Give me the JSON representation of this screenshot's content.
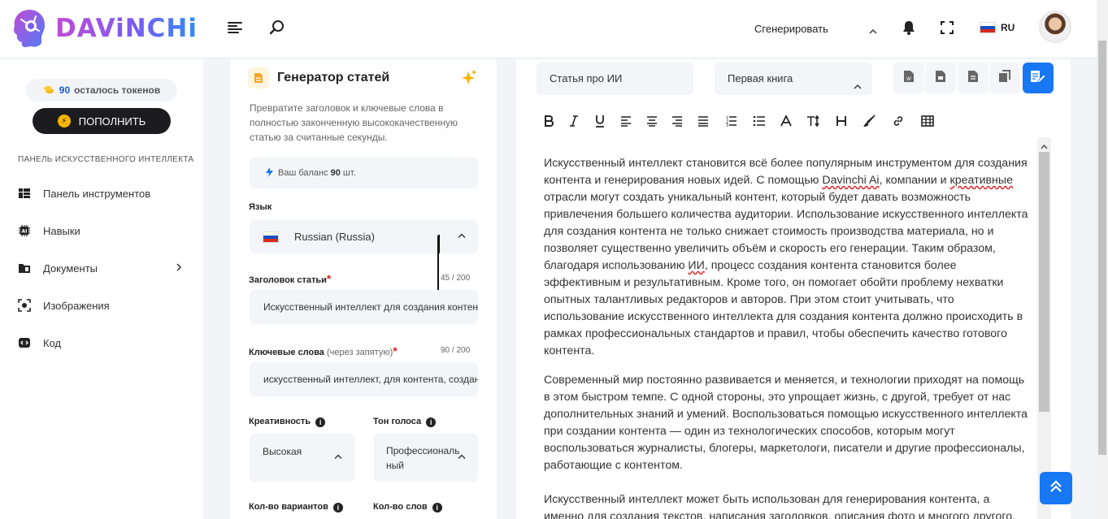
{
  "brand": {
    "name": "DAViNCHi"
  },
  "header": {
    "generate_label": "Сгенерировать",
    "language": "RU"
  },
  "sidebar": {
    "tokens_count": "90",
    "tokens_text": "осталось токенов",
    "topup_label": "ПОПОЛНИТЬ",
    "section_title": "ПАНЕЛЬ ИСКУССТВЕННОГО ИНТЕЛЛЕКТА",
    "items": [
      {
        "label": "Панель инструментов",
        "icon": "dashboard-icon"
      },
      {
        "label": "Навыки",
        "icon": "ai-chip-icon"
      },
      {
        "label": "Документы",
        "icon": "folder-icon"
      },
      {
        "label": "Изображения",
        "icon": "image-icon"
      },
      {
        "label": "Код",
        "icon": "code-icon"
      }
    ]
  },
  "form": {
    "title": "Генератор статей",
    "description": "Превратите заголовок и ключевые слова в полностью законченную высококачественную статью за считанные секунды.",
    "balance_prefix": "Ваш баланс",
    "balance_value": "90",
    "balance_suffix": "шт.",
    "language_label": "Язык",
    "language_value": "Russian (Russia)",
    "title_label": "Заголовок статьи",
    "title_counter": "45 / 200",
    "title_value": "Искусственный интеллект для создания контента",
    "keywords_label": "Ключевые слова",
    "keywords_hint": "(через запятую)",
    "keywords_counter": "90 / 200",
    "keywords_value": "искусственный интеллект, для контента, создание контента, генерирование идей",
    "creativity_label": "Креативность",
    "creativity_value": "Высокая",
    "tone_label": "Тон голоса",
    "tone_value_1": "Профессиональ",
    "tone_value_2": "ный",
    "variants_label": "Кол-во вариантов",
    "words_label": "Кол-во слов"
  },
  "editor": {
    "doc_name": "Статья про ИИ",
    "folder_value": "Первая книга",
    "paragraphs": {
      "p1_a": "Искусственный интеллект становится всё более популярным инструментом для создания контента и генерирования новых идей. С помощью ",
      "p1_davinchi": "Davinchi Ai",
      "p1_b": ", компании и ",
      "p1_creative": "креативные",
      "p1_c": " отрасли могут создать уникальный контент, который будет давать возможность привлечения большего количества аудитории. Использование искусственного интеллекта для создания контента не только снижает стоимость производства материала, но и позволяет существенно увеличить объём и скорость его генерации. Таким образом, благодаря использованию ",
      "p1_ii": "ИИ",
      "p1_d": ", процесс создания контента становится более эффективным и результативным. Кроме того, он помогает обойти проблему нехватки опытных  талантливых редакторов и авторов. При этом стоит учитывать, что использование искусственного интеллекта для создания контента должно происходить в рамках профессиональных стандартов и правил, чтобы обеспечить качество готового контента.",
      "p2": "Современный мир постоянно развивается и меняется, и технологии приходят на помощь в этом быстром темпе. С одной стороны, это упрощает жизнь, с другой, требует от нас дополнительных знаний и умений. Воспользоваться помощью искусственного интеллекта при создании контента — один из технологических способов, которым могут воспользоваться журналисты, блогеры, маркетологи, писатели и другие профессионалы, работающие с контентом.",
      "p3": "Искусственный интеллект может быть использован для генерирования контента, а именно для создания текстов, написания заголовков, описания фото и многого другого."
    }
  },
  "colors": {
    "accent": "#1877f2",
    "brand_gradient_start": "#c04bd6",
    "brand_gradient_end": "#2f8df5",
    "required": "#e02020"
  }
}
